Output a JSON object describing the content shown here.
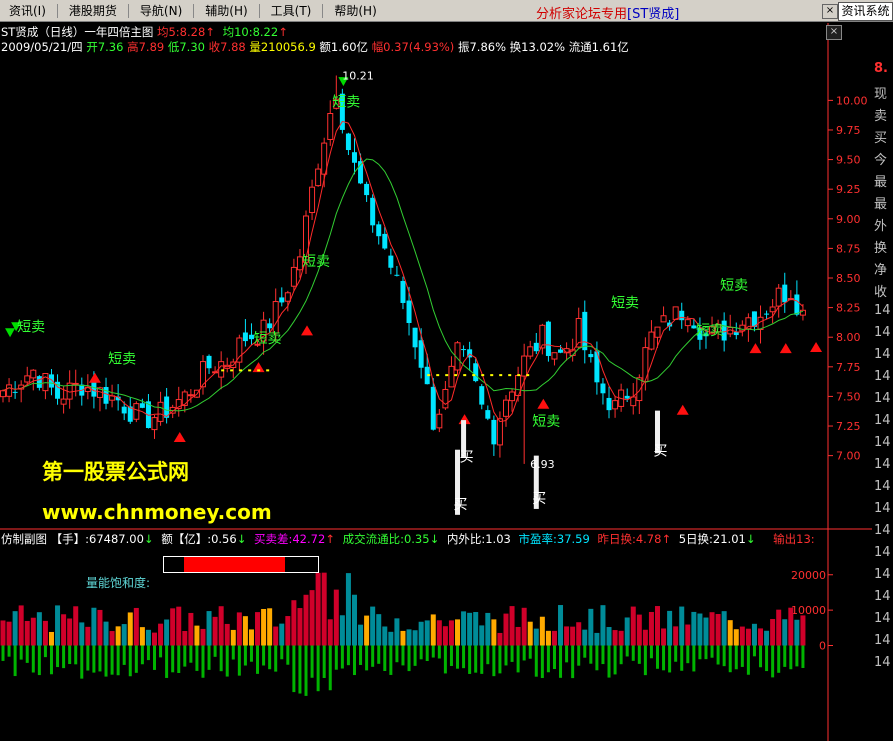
{
  "menu": [
    {
      "name": "menu-info",
      "label": "资讯(I)"
    },
    {
      "name": "menu-hk-futures",
      "label": "港股期货"
    },
    {
      "name": "menu-navigate",
      "label": "导航(N)"
    },
    {
      "name": "menu-assist",
      "label": "辅助(H)"
    },
    {
      "name": "menu-tools",
      "label": "工具(T)"
    },
    {
      "name": "menu-help",
      "label": "帮助(H)"
    }
  ],
  "banner": {
    "prefix": "分析家论坛专用",
    "stock": "[ST贤成]"
  },
  "system_button": "资讯系统",
  "close_glyph": "×",
  "header": {
    "title": "ST贤成（日线）一年四倍主图",
    "ma5_label": "均5:8.28",
    "ma5_arrow": "↑",
    "ma10_label": "均10:8.22",
    "ma10_arrow": "↑"
  },
  "quote": {
    "date": "2009/05/21/四",
    "open": "开7.36",
    "high": "高7.89",
    "low": "低7.30",
    "close": "收7.88",
    "volume": "量210056.9",
    "amount": "额1.60亿",
    "change": "幅0.37(4.93%)",
    "amplitude": "振7.86%",
    "turnover": "换13.02%",
    "float": "流通1.61亿"
  },
  "sub_header": {
    "title": "仿制副图",
    "hand": "【手】:67487.00",
    "amount": "额【亿】:0.56",
    "spread": "买卖差:42.72",
    "flow_ratio": "成交流通比:0.35",
    "inout": "内外比:1.03",
    "pe": "市盈率:37.59",
    "prev_turn": "昨日换:4.78",
    "turn5": "5日换:21.01",
    "output": "输出13:",
    "arrow_up": "↑",
    "arrow_down": "↓"
  },
  "watermark": {
    "cn": "第一股票公式网",
    "url": "www.chnmoney.com"
  },
  "saturation": {
    "label": "量能饱和度:",
    "value_pct": 74
  },
  "right_panel": [
    "8.",
    "现",
    "卖",
    "买",
    "今",
    "最",
    "最",
    "外",
    "换",
    "净",
    "收",
    "14",
    "14",
    "14",
    "14",
    "14",
    "14",
    "14",
    "14",
    "14",
    "14",
    "14",
    "14",
    "14",
    "14",
    "14",
    "14",
    "14"
  ],
  "colors": {
    "up": "#ff3030",
    "down": "#00e5ff",
    "ma5": "#ff2a2a",
    "ma10": "#32cd32",
    "vol_pos_red": "#d0002a",
    "vol_pos_teal": "#008c99",
    "vol_pos_yellow": "#ffaa00",
    "vol_neg": "#00b400",
    "signal_text": "#33ff33",
    "axis": "#ff3030"
  },
  "chart_data": {
    "type": "candlestick",
    "price_axis": {
      "ticks": [
        "10.00",
        "9.75",
        "9.50",
        "9.25",
        "9.00",
        "8.75",
        "8.50",
        "8.25",
        "8.00",
        "7.75",
        "7.50",
        "7.25",
        "7.00"
      ],
      "min": 6.6,
      "max": 10.4
    },
    "volume_axis": {
      "ticks": [
        "20000",
        "10000",
        "0"
      ],
      "min": -27000,
      "max": 27000
    },
    "anchors": [
      {
        "i": 0,
        "c": 7.55
      },
      {
        "i": 5,
        "c": 7.72
      },
      {
        "i": 9,
        "c": 7.5
      },
      {
        "i": 13,
        "c": 7.6
      },
      {
        "i": 19,
        "c": 7.47
      },
      {
        "i": 23,
        "c": 7.3
      },
      {
        "i": 26,
        "c": 7.35
      },
      {
        "i": 30,
        "c": 7.5
      },
      {
        "i": 34,
        "c": 7.75
      },
      {
        "i": 37,
        "c": 7.8
      },
      {
        "i": 40,
        "c": 8.0
      },
      {
        "i": 43,
        "c": 8.05
      },
      {
        "i": 46,
        "c": 8.3
      },
      {
        "i": 49,
        "c": 8.7
      },
      {
        "i": 52,
        "c": 9.5
      },
      {
        "i": 55,
        "c": 10.1
      },
      {
        "i": 57,
        "c": 9.6
      },
      {
        "i": 60,
        "c": 9.1
      },
      {
        "i": 63,
        "c": 8.75
      },
      {
        "i": 66,
        "c": 8.3
      },
      {
        "i": 69,
        "c": 7.8
      },
      {
        "i": 71,
        "c": 7.3
      },
      {
        "i": 73,
        "c": 7.5
      },
      {
        "i": 75,
        "c": 7.85
      },
      {
        "i": 77,
        "c": 7.75
      },
      {
        "i": 79,
        "c": 7.4
      },
      {
        "i": 81,
        "c": 7.2
      },
      {
        "i": 83,
        "c": 7.5
      },
      {
        "i": 86,
        "c": 7.8
      },
      {
        "i": 89,
        "c": 8.0
      },
      {
        "i": 92,
        "c": 7.85
      },
      {
        "i": 95,
        "c": 8.05
      },
      {
        "i": 98,
        "c": 7.6
      },
      {
        "i": 101,
        "c": 7.4
      },
      {
        "i": 104,
        "c": 7.6
      },
      {
        "i": 107,
        "c": 8.0
      },
      {
        "i": 110,
        "c": 8.15
      },
      {
        "i": 113,
        "c": 8.25
      },
      {
        "i": 116,
        "c": 8.0
      },
      {
        "i": 119,
        "c": 8.05
      },
      {
        "i": 122,
        "c": 8.15
      },
      {
        "i": 125,
        "c": 8.2
      },
      {
        "i": 128,
        "c": 8.35
      },
      {
        "i": 130,
        "c": 8.4
      },
      {
        "i": 132,
        "c": 8.2
      }
    ],
    "candle_count": 133,
    "labels": [
      {
        "text": "短卖",
        "i": 3,
        "price": 8.05,
        "color": "#33ff33"
      },
      {
        "text": "短卖",
        "i": 18,
        "price": 7.78,
        "color": "#33ff33"
      },
      {
        "text": "短卖",
        "i": 42,
        "price": 7.95,
        "color": "#33ff33"
      },
      {
        "text": "短卖",
        "i": 50,
        "price": 8.6,
        "color": "#33ff33"
      },
      {
        "text": "短卖",
        "i": 55,
        "price": 9.95,
        "color": "#33ff33"
      },
      {
        "text": "短卖",
        "i": 88,
        "price": 7.25,
        "color": "#33ff33"
      },
      {
        "text": "短卖",
        "i": 101,
        "price": 8.25,
        "color": "#33ff33"
      },
      {
        "text": "短卖",
        "i": 115,
        "price": 8.02,
        "color": "#33ff33"
      },
      {
        "text": "短卖",
        "i": 119,
        "price": 8.4,
        "color": "#33ff33"
      },
      {
        "text": "买",
        "i": 76,
        "price": 6.95,
        "color": "#ffffff"
      },
      {
        "text": "买",
        "i": 75,
        "price": 6.55,
        "color": "#ffffff"
      },
      {
        "text": "买",
        "i": 88,
        "price": 6.6,
        "color": "#ffffff"
      },
      {
        "text": "买",
        "i": 108,
        "price": 7.0,
        "color": "#ffffff"
      }
    ],
    "price_notes": [
      {
        "text": "10.21",
        "i": 55,
        "price": 10.21
      },
      {
        "text": "6.93",
        "i": 86,
        "price": 6.93
      }
    ],
    "up_triangles": [
      {
        "i": 15,
        "price": 7.7
      },
      {
        "i": 29,
        "price": 7.2
      },
      {
        "i": 42,
        "price": 7.79
      },
      {
        "i": 50,
        "price": 8.1
      },
      {
        "i": 76,
        "price": 7.35
      },
      {
        "i": 89,
        "price": 7.48
      },
      {
        "i": 112,
        "price": 7.43
      },
      {
        "i": 124,
        "price": 7.95
      },
      {
        "i": 129,
        "price": 7.95
      },
      {
        "i": 134,
        "price": 7.96
      }
    ],
    "down_triangles": [
      {
        "i": 1,
        "price": 8.0
      },
      {
        "i": 2,
        "price": 8.05
      },
      {
        "i": 56,
        "price": 10.12
      }
    ]
  }
}
